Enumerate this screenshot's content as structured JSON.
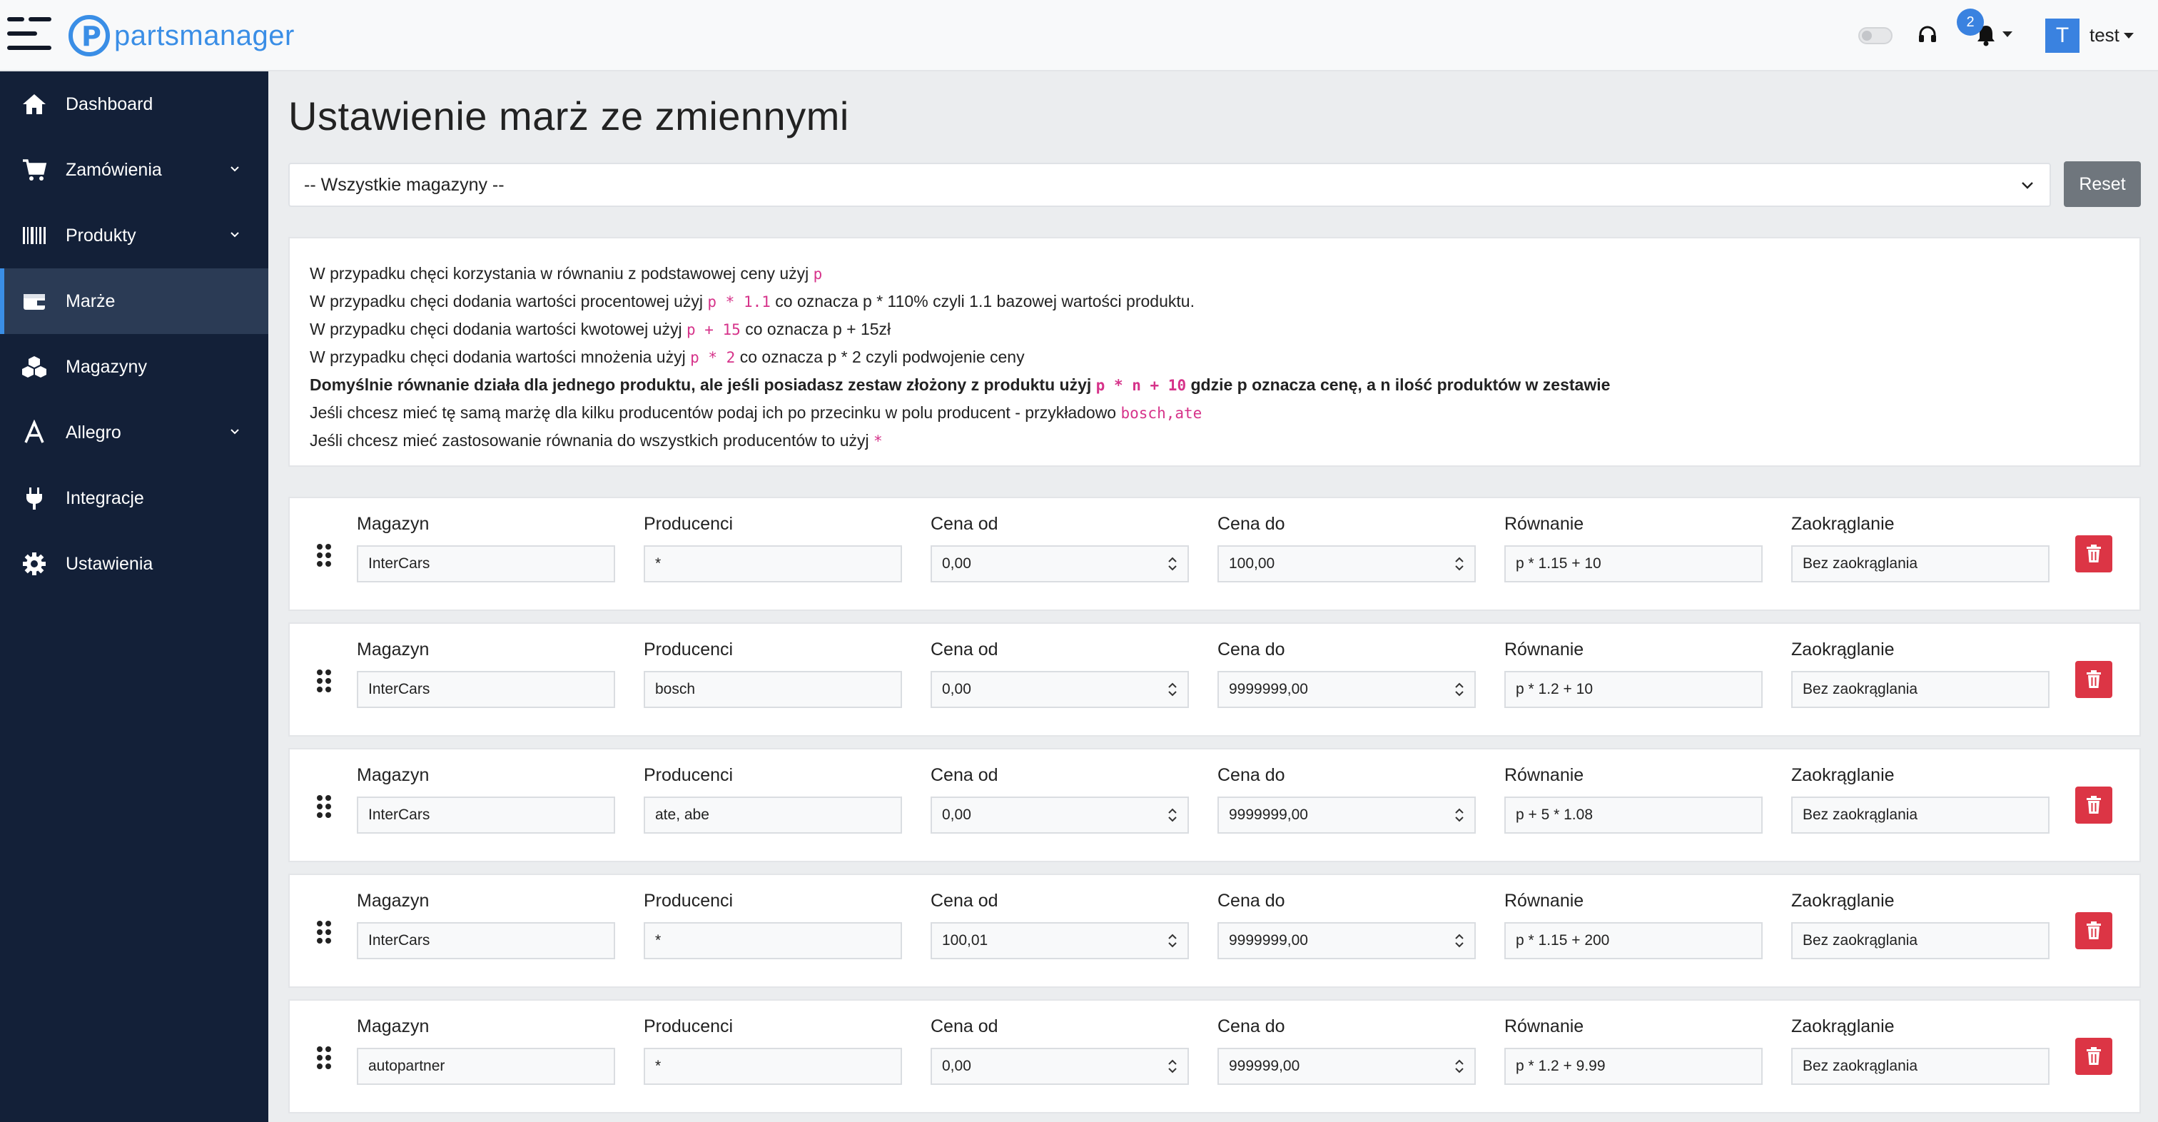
{
  "header": {
    "logo_text": "partsmanager",
    "notification_count": "2",
    "user_initial": "T",
    "user_name": "test",
    "accent_color": "#3a8ee6"
  },
  "sidebar": {
    "items": [
      {
        "label": "Dashboard",
        "icon": "home-icon",
        "has_submenu": false
      },
      {
        "label": "Zamówienia",
        "icon": "cart-icon",
        "has_submenu": true
      },
      {
        "label": "Produkty",
        "icon": "barcode-icon",
        "has_submenu": true
      },
      {
        "label": "Marże",
        "icon": "wallet-icon",
        "has_submenu": false,
        "active": true
      },
      {
        "label": "Magazyny",
        "icon": "boxes-icon",
        "has_submenu": false
      },
      {
        "label": "Allegro",
        "icon": "allegro-a-icon",
        "has_submenu": true
      },
      {
        "label": "Integracje",
        "icon": "plug-icon",
        "has_submenu": false
      },
      {
        "label": "Ustawienia",
        "icon": "gear-icon",
        "has_submenu": false
      }
    ]
  },
  "main": {
    "title": "Ustawienie marż ze zmiennymi",
    "warehouse_select": "-- Wszystkie magazyny --",
    "reset_label": "Reset",
    "info": {
      "l1_text": "W przypadku chęci korzystania w równaniu z podstawowej ceny użyj",
      "l1_code": "p",
      "l2_text": "W przypadku chęci dodania wartości procentowej użyj",
      "l2_code": "p * 1.1",
      "l2_after": "co oznacza p * 110% czyli 1.1 bazowej wartości produktu.",
      "l3_text": "W przypadku chęci dodania wartości kwotowej użyj",
      "l3_code": "p + 15",
      "l3_after": "co oznacza p + 15zł",
      "l4_text": "W przypadku chęci dodania wartości mnożenia użyj",
      "l4_code": "p * 2",
      "l4_after": "co oznacza p * 2 czyli podwojenie ceny",
      "l5_text": "Domyślnie równanie działa dla jednego produktu, ale jeśli posiadasz zestaw złożony z produktu użyj",
      "l5_code": "p * n + 10",
      "l5_after": "gdzie p oznacza cenę, a n ilość produktów w zestawie",
      "l6_text": "Jeśli chcesz mieć tę samą marżę dla kilku producentów podaj ich po przecinku w polu producent - przykładowo",
      "l6_code": "bosch,ate",
      "l7_text": "Jeśli chcesz mieć zastosowanie równania do wszystkich producentów to użyj",
      "l7_code": "*"
    },
    "column_labels": {
      "warehouse": "Magazyn",
      "producers": "Producenci",
      "price_from": "Cena od",
      "price_to": "Cena do",
      "equation": "Równanie",
      "rounding": "Zaokrąglanie"
    },
    "rules": [
      {
        "warehouse": "InterCars",
        "producers": "*",
        "price_from": "0,00",
        "price_to": "100,00",
        "equation": "p * 1.15 + 10",
        "rounding": "Bez zaokrąglania"
      },
      {
        "warehouse": "InterCars",
        "producers": "bosch",
        "price_from": "0,00",
        "price_to": "9999999,00",
        "equation": "p * 1.2 + 10",
        "rounding": "Bez zaokrąglania"
      },
      {
        "warehouse": "InterCars",
        "producers": "ate, abe",
        "price_from": "0,00",
        "price_to": "9999999,00",
        "equation": "p + 5 * 1.08",
        "rounding": "Bez zaokrąglania"
      },
      {
        "warehouse": "InterCars",
        "producers": "*",
        "price_from": "100,01",
        "price_to": "9999999,00",
        "equation": "p * 1.15 + 200",
        "rounding": "Bez zaokrąglania"
      },
      {
        "warehouse": "autopartner",
        "producers": "*",
        "price_from": "0,00",
        "price_to": "999999,00",
        "equation": "p * 1.2 + 9.99",
        "rounding": "Bez zaokrąglania"
      }
    ],
    "delete_color": "#dc3545"
  }
}
